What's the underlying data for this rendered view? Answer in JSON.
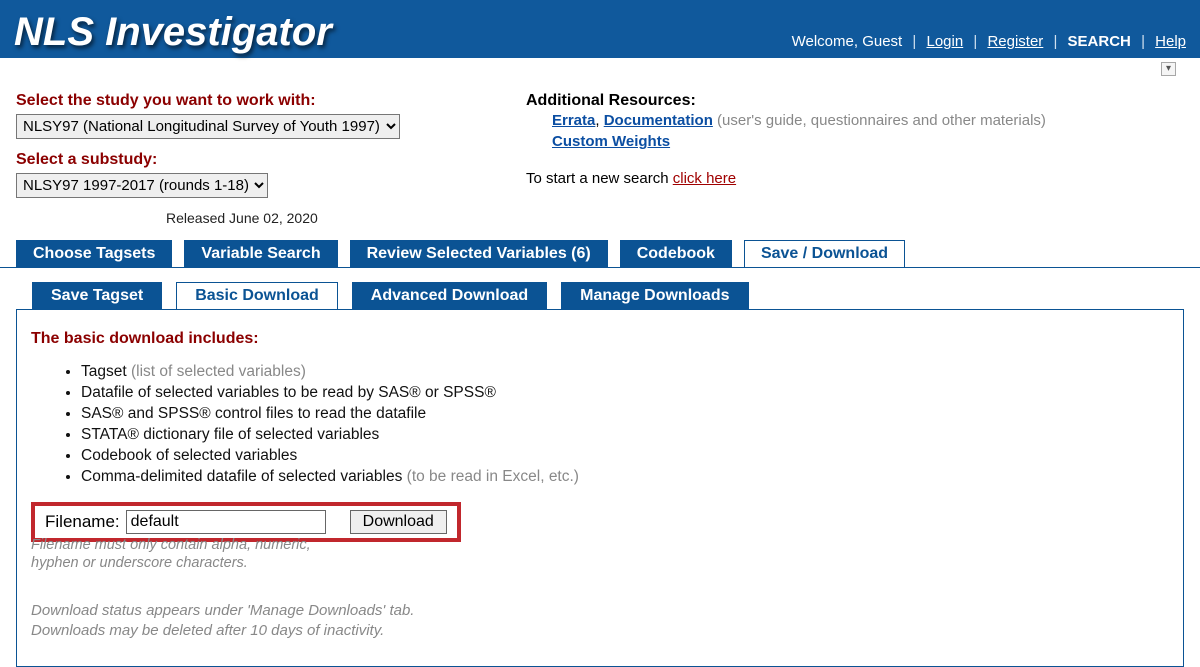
{
  "header": {
    "title": "NLS Investigator",
    "welcome": "Welcome, Guest",
    "links": {
      "login": "Login",
      "register": "Register",
      "search": "SEARCH",
      "help": "Help"
    }
  },
  "study": {
    "label": "Select the study you want to work with:",
    "value": "NLSY97 (National Longitudinal Survey of Youth 1997)"
  },
  "substudy": {
    "label": "Select a substudy:",
    "value": "NLSY97 1997-2017 (rounds 1-18)",
    "released": "Released June 02, 2020"
  },
  "resources": {
    "heading": "Additional Resources:",
    "errata": "Errata",
    "documentation": "Documentation",
    "doc_note": "(user's guide, questionnaires and other materials)",
    "custom_weights": "Custom Weights",
    "start_prefix": "To start a new search ",
    "start_link": "click here"
  },
  "tabs_primary": [
    "Choose Tagsets",
    "Variable Search",
    "Review Selected Variables (6)",
    "Codebook",
    "Save / Download"
  ],
  "tabs_secondary": [
    "Save Tagset",
    "Basic Download",
    "Advanced Download",
    "Manage Downloads"
  ],
  "content": {
    "title": "The basic download includes:",
    "items": [
      {
        "text": "Tagset ",
        "muted": "(list of selected variables)"
      },
      {
        "text": "Datafile of selected variables to be read by SAS® or SPSS®"
      },
      {
        "text": "SAS® and SPSS® control files to read the datafile"
      },
      {
        "text": "STATA® dictionary file of selected variables"
      },
      {
        "text": "Codebook of selected variables"
      },
      {
        "text": "Comma-delimited datafile of selected variables ",
        "muted": "(to be read in Excel, etc.)"
      }
    ],
    "filename_label": "Filename:",
    "filename_value": "default",
    "download_label": "Download",
    "filename_hint1": "Filename must only contain alpha, numeric,",
    "filename_hint2": "hyphen or underscore characters.",
    "note1": "Download status appears under 'Manage Downloads' tab.",
    "note2": "Downloads may be deleted after 10 days of inactivity."
  }
}
